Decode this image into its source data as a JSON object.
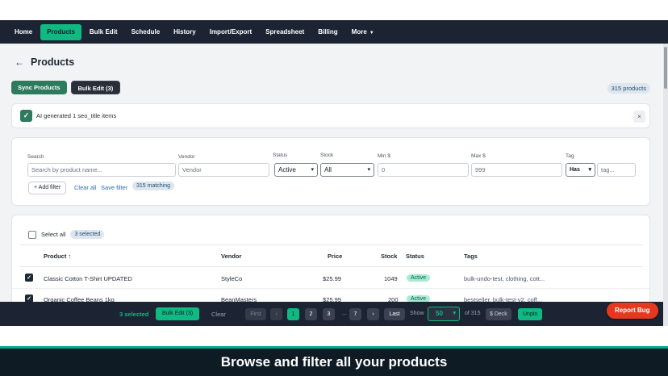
{
  "nav": {
    "items": [
      "Home",
      "Products",
      "Bulk Edit",
      "Schedule",
      "History",
      "Import/Export",
      "Spreadsheet",
      "Billing",
      "More"
    ],
    "active": "Products"
  },
  "page": {
    "back_icon": "arrow-left-icon",
    "title": "Products",
    "sync_label": "Sync Products",
    "bulk_label": "Bulk Edit (3)",
    "count_badge": "315 products"
  },
  "banner": {
    "text": "AI generated 1 seo_title items",
    "close": "×"
  },
  "filters": {
    "search_label": "Search",
    "search_placeholder": "Search by product name...",
    "vendor_label": "Vendor",
    "vendor_placeholder": "Vendor",
    "status_label": "Status",
    "status_value": "Active",
    "stock_label": "Stock",
    "stock_value": "All",
    "min_label": "Min $",
    "min_placeholder": "0",
    "max_label": "Max $",
    "max_placeholder": "999",
    "tag_label": "Tag",
    "tag_mode": "Has",
    "tag_placeholder": "tag...",
    "add_filter": "+ Add filter",
    "clear_all": "Clear all",
    "save_filter": "Save filter",
    "matching": "315 matching"
  },
  "table": {
    "select_all": "Select all",
    "selected_badge": "3 selected",
    "headers": [
      "Product ↑",
      "Vendor",
      "Price",
      "Stock",
      "Status",
      "Tags"
    ],
    "rows": [
      {
        "product": "Classic Cotton T-Shirt UPDATED",
        "vendor": "StyleCo",
        "price": "$25.99",
        "stock": "1049",
        "status": "Active",
        "tags": "bulk-undo-test, clothing, cott..."
      },
      {
        "product": "Organic Coffee Beans 1kg",
        "vendor": "BeanMasters",
        "price": "$25.99",
        "stock": "200",
        "status": "Active",
        "tags": "bestseller, bulk-test-v2, coff..."
      }
    ]
  },
  "bottom": {
    "selected": "3 selected",
    "bulk": "Bulk Edit (3)",
    "clear": "Clear",
    "first": "First",
    "prev": "‹",
    "pages": [
      "1",
      "2",
      "3"
    ],
    "dots": "...",
    "last_page": "7",
    "next": "›",
    "last": "Last",
    "show": "Show",
    "per_page": "50",
    "of_total": "of 315",
    "deck": "$ Deck",
    "unpin": "Unpin",
    "report_bug": "Report Bug"
  },
  "caption": "Browse and filter all your products",
  "colors": {
    "nav_bg": "#1c2333",
    "accent": "#10b981",
    "sync_green": "#2d7a5f",
    "report_red": "#e5391f",
    "caption_bg": "#0f1b24"
  }
}
